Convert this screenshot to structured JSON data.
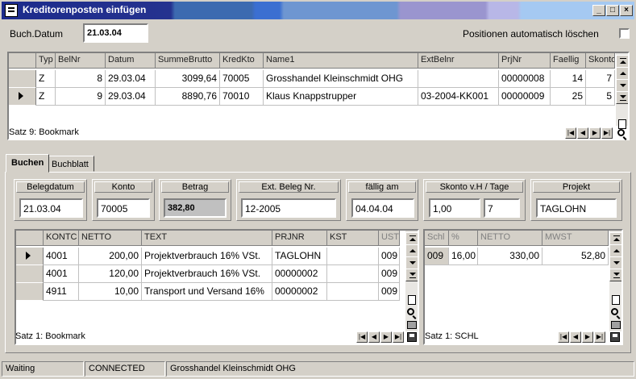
{
  "window": {
    "title": "Kreditorenposten einfügen"
  },
  "header": {
    "buchdatum_label": "Buch.Datum",
    "buchdatum_value": "21.03.04",
    "auto_delete_label": "Positionen automatisch löschen",
    "auto_delete_checked": false
  },
  "top_grid": {
    "columns": [
      "Typ",
      "BelNr",
      "Datum",
      "SummeBrutto",
      "KredKto",
      "Name1",
      "ExtBelnr",
      "PrjNr",
      "Faellig",
      "Skonto"
    ],
    "rows": [
      [
        "Z",
        "8",
        "29.03.04",
        "3099,64",
        "70005",
        "Grosshandel Kleinschmidt OHG",
        "",
        "00000008",
        "14",
        "7"
      ],
      [
        "Z",
        "9",
        "29.03.04",
        "8890,76",
        "70010",
        "Klaus Knappstrupper",
        "03-2004-KK001",
        "00000009",
        "25",
        "5"
      ]
    ],
    "current_row": 1,
    "status": "Satz 9: Bookmark"
  },
  "tabs": [
    {
      "label": "Buchen",
      "active": true
    },
    {
      "label": "Buchblatt",
      "active": false
    }
  ],
  "fields": {
    "belegdatum": {
      "label": "Belegdatum",
      "value": "21.03.04"
    },
    "konto": {
      "label": "Konto",
      "value": "70005"
    },
    "betrag": {
      "label": "Betrag",
      "value": "382,80"
    },
    "extbeleg": {
      "label": "Ext. Beleg Nr.",
      "value": "12-2005"
    },
    "faellig": {
      "label": "fällig am",
      "value": "04.04.04"
    },
    "skonto": {
      "label": "Skonto  v.H / Tage",
      "value_pct": "1,00",
      "value_days": "7"
    },
    "projekt": {
      "label": "Projekt",
      "value": "TAGLOHN"
    }
  },
  "left_grid": {
    "columns": [
      "KONTC",
      "NETTO",
      "TEXT",
      "PRJNR",
      "KST",
      "UST"
    ],
    "rows": [
      [
        "4001",
        "200,00",
        "Projektverbrauch 16% VSt.",
        "TAGLOHN",
        "",
        "009"
      ],
      [
        "4001",
        "120,00",
        "Projektverbrauch 16% VSt.",
        "00000002",
        "",
        "009"
      ],
      [
        "4911",
        "10,00",
        "Transport und Versand 16%",
        "00000002",
        "",
        "009"
      ]
    ],
    "current_row": 0,
    "status": "Satz 1: Bookmark"
  },
  "right_grid": {
    "columns": [
      "Schl",
      "%",
      "NETTO",
      "MWST"
    ],
    "rows": [
      [
        "009",
        "16,00",
        "330,00",
        "52,80"
      ]
    ],
    "status": "Satz 1: SCHL"
  },
  "statusbar": {
    "state": "Waiting",
    "connection": "CONNECTED",
    "customer": "Grosshandel Kleinschmidt OHG"
  }
}
